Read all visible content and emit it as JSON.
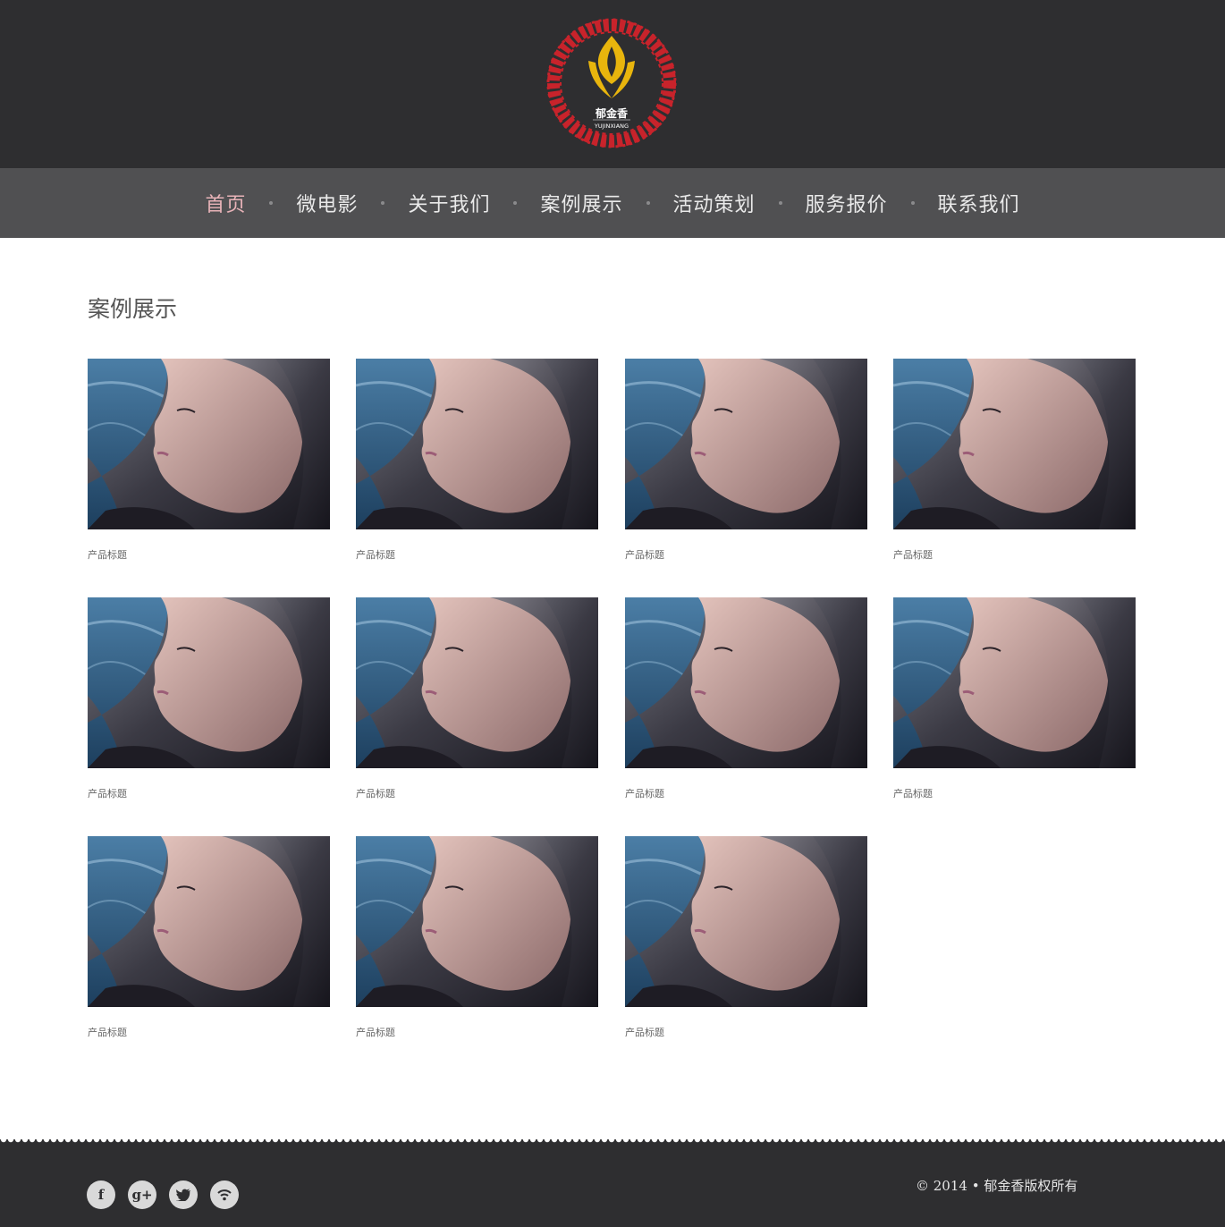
{
  "brand": {
    "logo_name_cn": "郁金香",
    "logo_name_en": "YUJINXIANG"
  },
  "nav": {
    "items": [
      {
        "label": "首页",
        "active": true
      },
      {
        "label": "微电影",
        "active": false
      },
      {
        "label": "关于我们",
        "active": false
      },
      {
        "label": "案例展示",
        "active": false
      },
      {
        "label": "活动策划",
        "active": false
      },
      {
        "label": "服务报价",
        "active": false
      },
      {
        "label": "联系我们",
        "active": false
      }
    ]
  },
  "main": {
    "title": "案例展示",
    "cards": [
      {
        "title": "产品标题"
      },
      {
        "title": "产品标题"
      },
      {
        "title": "产品标题"
      },
      {
        "title": "产品标题"
      },
      {
        "title": "产品标题"
      },
      {
        "title": "产品标题"
      },
      {
        "title": "产品标题"
      },
      {
        "title": "产品标题"
      },
      {
        "title": "产品标题"
      },
      {
        "title": "产品标题"
      },
      {
        "title": "产品标题"
      }
    ]
  },
  "footer": {
    "socials": [
      {
        "icon": "facebook-icon",
        "glyph": "f"
      },
      {
        "icon": "google-plus-icon",
        "glyph": "g+"
      },
      {
        "icon": "twitter-icon",
        "glyph": ""
      },
      {
        "icon": "rss-icon",
        "glyph": ""
      }
    ],
    "copyright": "© 2014 • 郁金香版权所有"
  },
  "colors": {
    "header_bg": "#2e2e30",
    "nav_bg": "#505052",
    "nav_active": "#e8b3b8",
    "logo_red": "#c8232b",
    "logo_gold": "#e8b50d"
  }
}
